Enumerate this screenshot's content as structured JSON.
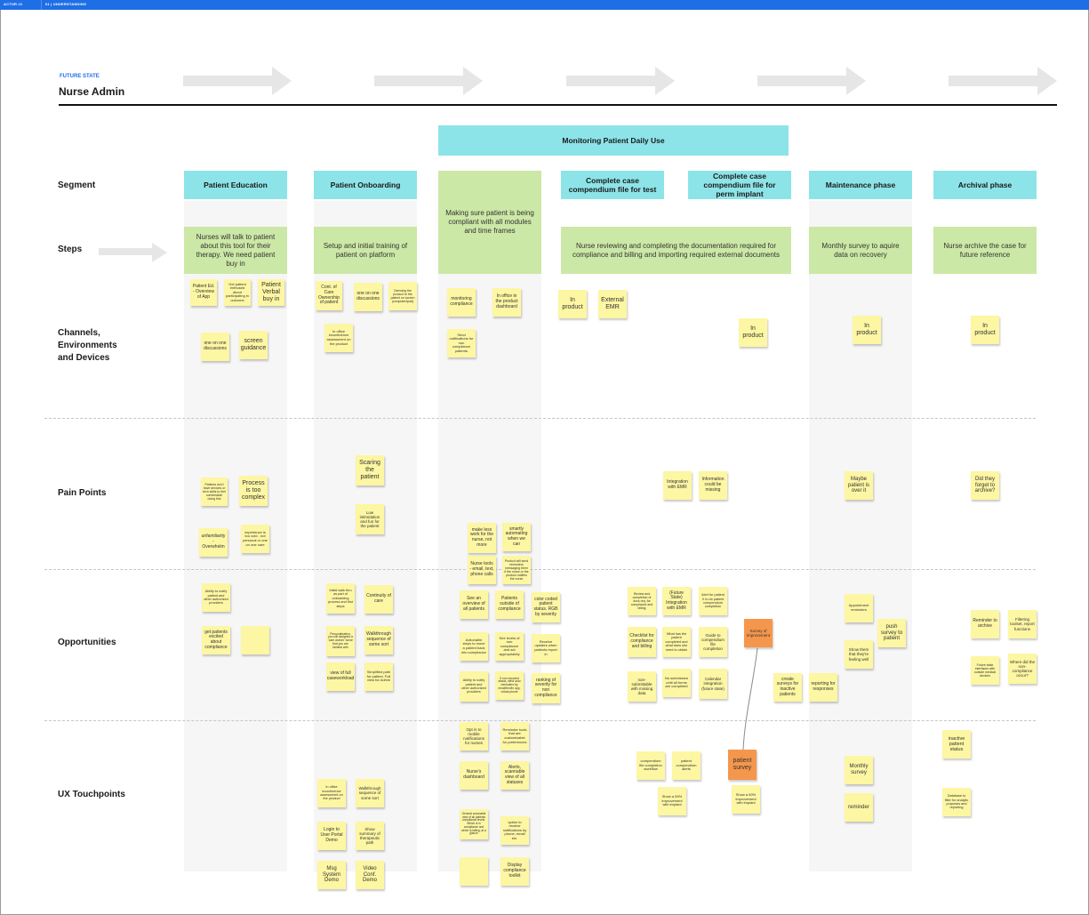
{
  "topbar": {
    "left": "ACTOR #1",
    "right": "01 | UNDERSTANDING"
  },
  "header": {
    "kicker": "FUTURE STATE",
    "title": "Nurse Admin"
  },
  "banner": "Monitoring Patient Daily Use",
  "rows": {
    "segment": "Segment",
    "steps": "Steps",
    "channels": "Channels, Environments and Devices",
    "pain": "Pain Points",
    "opportunities": "Opportunities",
    "ux": "UX Touchpoints"
  },
  "segments": [
    "Patient Education",
    "Patient Onboarding",
    "Making sure patient is being compliant with all modules and time frames",
    "Complete case compendium file for test",
    "Complete case compendium file for perm implant",
    "Maintenance phase",
    "Archival phase"
  ],
  "steps": [
    "Nurses will talk to patient about this tool for their therapy. We need patient buy in",
    "Setup and initial training of patient on platform",
    "Nurse reviewing and completing the documentation required for compliance and billing and importing required external documents",
    "Monthly survey to aquire data on recovery",
    "Nurse archive the case for future reference"
  ],
  "notes": {
    "ch_edu_1": "Patient Ed. - Overview of App",
    "ch_edu_2": "Get patient enthused about participating in outcome",
    "ch_edu_3": "Patient Verbal buy in",
    "ch_edu_4": "one on one discussions",
    "ch_edu_5": "screen guidance",
    "ch_onb_1": "Cont. of Care Ownership of patient",
    "ch_onb_2": "one on one discussions",
    "ch_onb_3": "Demoing the product to the patient on screen (computer/ipad)",
    "ch_onb_4": "In office incontinence assessment on the product",
    "ch_mon_1": "monitoring compliance",
    "ch_mon_2": "In office in the product dashboard",
    "ch_mon_3": "Send notifications for non compliance patients",
    "ch_test_1": "In product",
    "ch_test_2": "External EMR",
    "ch_perm_1": "In product",
    "ch_maint_1": "In product",
    "ch_arch_1": "In product",
    "pp_edu_1": "Patients don't have devices or tech skills to feel comfortable doing this",
    "pp_edu_2": "Process is too complex",
    "pp_edu_3": "unfamiliarity - Overwhelm",
    "pp_edu_4": "experience is too cold - not personal or one on one care",
    "pp_onb_1": "Scaring the patient",
    "pp_onb_2": "Low intimidation and fun for the patient",
    "pp_mon_1": "make less work for the nurse, not more",
    "pp_mon_2": "smartly automating when we can",
    "pp_mon_3": "Nurse tools - email, text, phone calls",
    "pp_mon_4": "Product will send reminders messaging them if the nurse or the product notifies the nurse",
    "pp_test_1": "Integration with EMR",
    "pp_test_2": "Information could be missing",
    "pp_maint_1": "Maybe patient is over it",
    "pp_arch_1": "Did they forget to archive?",
    "op_edu_1": "Ability to notify patient and other authorized providers",
    "op_edu_2": "get patients excited about compliance",
    "op_onb_1": "Initial walk thru as part of onboarding process and first steps",
    "op_onb_2": "Continuity of care",
    "op_onb_3": "Personalization, you will assigned a 'care worker' nurse that you are familiar with",
    "op_onb_4": "Walkthrough sequence of some sort",
    "op_onb_5": "view of full caseworkload",
    "op_onb_6": "Simplified path for patient. Full view for Admin",
    "op_mon_1": "See an overview of all patients",
    "op_mon_2": "Patients outside of compliance",
    "op_mon_3": "color coded patient status. RGB by severity",
    "op_mon_4": "Actionable steps to move a patient back into compliance",
    "op_mon_5": "See levels of non compliance and act appropriately",
    "op_mon_6": "Receive updates when patients report in",
    "op_mon_7": "Ability to notify patient and other authorized providers",
    "op_mon_8": "If non reported status, send auto reminders by email/text/in app, virtual phone",
    "op_mon_9": "ranking of severity for non compliance",
    "op_doc_1": "Review and completion of docs req. for compliance and billing",
    "op_doc_2": "(Future State) Integration with EMR",
    "op_doc_3": "Alert for patient X to do patient compendium completion",
    "op_doc_4": "Checklist for compliance and billing",
    "op_doc_5": "What has the patient completed and what does she need to obtain",
    "op_doc_6": "Guide to compendium file completion",
    "op_doc_7": "Survey of improvement",
    "op_doc_8": "non-submittable with missing data",
    "op_doc_9": "No submission until all forms are completed",
    "op_doc_10": "Calendar integration (future state)",
    "op_doc_11": "create surveys for inactive patients",
    "op_doc_12": "reporting for responses",
    "op_maint_1": "Appointment reminders",
    "op_maint_2": "push survey to patient",
    "op_maint_3": "Show them that they're feeling well",
    "op_arch_1": "Reminder to archive",
    "op_arch_2": "Filtering toolset, report functions",
    "op_arch_3": "Future state interfaces with outside medical devices",
    "op_arch_4": "Where did the non-compliance occur?",
    "ux_onb_1": "In office incontinence assessment on the product",
    "ux_onb_2": "Walkthrough sequence of some sort",
    "ux_onb_3": "Login to User Portal Demo",
    "ux_onb_4": "Show summary of therapeutic path",
    "ux_onb_5": "Msg System Demo",
    "ux_onb_6": "Video Conf. Demo",
    "ux_mon_1": "Opt in to mobile notifications for nurses",
    "ux_mon_2": "Reminder tools that are customizable for preferences",
    "ux_mon_3": "Nurse's dashboard",
    "ux_mon_4": "Alerts, scannable view of all statuses",
    "ux_mon_5": "General scannable view of all patients compliance levels. Which is in compliance and which is falling, at a glance",
    "ux_mon_6": "option to receive notifications by phone, email etc.",
    "ux_mon_7": "Display compliance toolkit",
    "ux_doc_1": "compendium file completion workflow",
    "ux_doc_2": "patient compendium alerts",
    "ux_doc_3": "patient survey",
    "ux_doc_4": "Show a 50% improvement with implant",
    "ux_doc_5": "Show a 50% improvement with implant",
    "ux_maint_1": "Monthly survey",
    "ux_maint_2": "reminder",
    "ux_arch_1": "inactive patient status",
    "ux_arch_2": "Database to filter for analytic purposes and reporting"
  },
  "colors": {
    "segment": "#8de4e8",
    "step": "#cce8a6",
    "sticky": "#fdf6a3",
    "sticky_accent": "#f5964d",
    "accent": "#1e6ee6"
  }
}
